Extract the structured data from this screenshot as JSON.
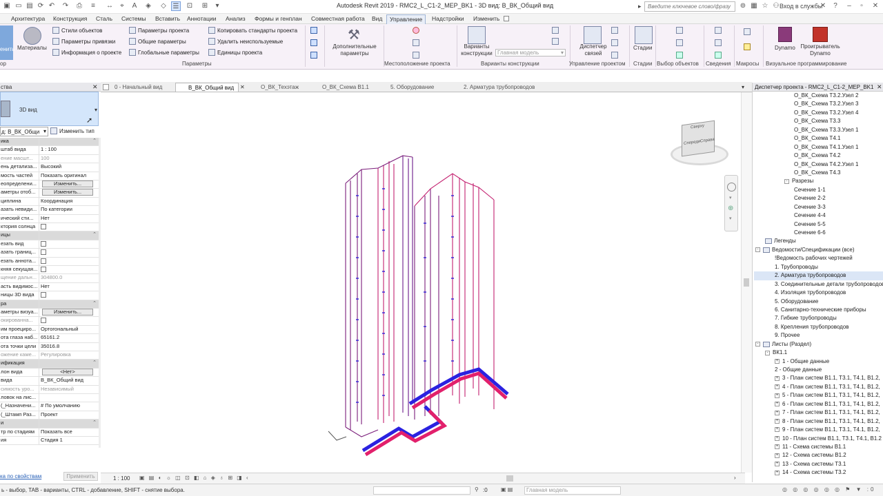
{
  "window": {
    "title": "Autodesk Revit 2019 - RMC2_L_C1-2_MEP_BK1 - 3D вид: В_ВК_Общий вид"
  },
  "search": {
    "placeholder": "Введите ключевое слово/фразу"
  },
  "account": {
    "signin": "Вход в службы"
  },
  "menu": {
    "tabs": [
      "Архитектура",
      "Конструкция",
      "Сталь",
      "Системы",
      "Вставить",
      "Аннотации",
      "Анализ",
      "Формы и генплан",
      "Совместная работа",
      "Вид",
      "Управление",
      "Надстройки",
      "Изменить"
    ],
    "active": "Управление"
  },
  "ribbon": {
    "left_label": "енить",
    "materials_label": "Материалы",
    "col1": [
      "Стили объектов",
      "Параметры привязки",
      "Информация о проекте"
    ],
    "col2": [
      "Параметры проекта",
      "Общие параметры",
      "Глобальные параметры"
    ],
    "col3": [
      "Копировать стандарты проекта",
      "Удалить неиспользуемые",
      "Единицы проекта"
    ],
    "addparams_label": "Дополнительные параметры",
    "design_options_label": "Варианты конструкции",
    "main_model": "Главная модель",
    "link_manager_label": "Диспетчер связей",
    "phases_label": "Стадии",
    "dynamo_label": "Dynamo",
    "dynamo_player_label": "Проигрыватель Dynamo",
    "panels": {
      "p_left": "ор",
      "params": "Параметры",
      "location": "Местоположение проекта",
      "design": "Варианты конструкции",
      "manage": "Управление проектом",
      "phases": "Стадии",
      "selection": "Выбор объектов",
      "inquiry": "Сведения",
      "macros": "Макросы",
      "visual": "Визуальное программирование"
    }
  },
  "properties": {
    "title": "ства",
    "type_name": "3D вид",
    "instance_select": "д: В_ВК_Общи",
    "edit_type": "Изменить тип",
    "rows": [
      {
        "k": "ика",
        "v": "",
        "grp": true
      },
      {
        "k": "штаб вида",
        "v": "1 : 100"
      },
      {
        "k": "ение масшт...",
        "v": "100",
        "dim": true
      },
      {
        "k": "ень детализа...",
        "v": "Высокий"
      },
      {
        "k": "мость частей",
        "v": "Показать оригинал"
      },
      {
        "k": "еопределени...",
        "v": "Изменить...",
        "btn": true
      },
      {
        "k": "аметры отоб...",
        "v": "Изменить...",
        "btn": true
      },
      {
        "k": "циплина",
        "v": "Координация"
      },
      {
        "k": "азать невиди...",
        "v": "По категории"
      },
      {
        "k": "ический сти...",
        "v": "Нет"
      },
      {
        "k": "ктория солнца",
        "v": "",
        "cb": true
      },
      {
        "k": "ицы",
        "v": "",
        "grp": true
      },
      {
        "k": "езать вид",
        "v": "",
        "cb": true
      },
      {
        "k": "азать границ...",
        "v": "",
        "cb": true
      },
      {
        "k": "езать аннота...",
        "v": "",
        "cb": true
      },
      {
        "k": "княя секущая...",
        "v": "",
        "cb": true
      },
      {
        "k": "щение дальн...",
        "v": "304800.0",
        "dim": true
      },
      {
        "k": "асть видимос...",
        "v": "Нет"
      },
      {
        "k": "ницы 3D вида",
        "v": "",
        "cb": true
      },
      {
        "k": "ра",
        "v": "",
        "grp": true
      },
      {
        "k": "аметры визуа...",
        "v": "Изменить...",
        "btn": true
      },
      {
        "k": "окированна...",
        "v": "",
        "cb": true,
        "dim": true
      },
      {
        "k": "им проециро...",
        "v": "Ортогональный"
      },
      {
        "k": "ота глаза наб...",
        "v": "65161.2"
      },
      {
        "k": "ота точки цели",
        "v": "35016.8"
      },
      {
        "k": "ожение каме...",
        "v": "Регулировка",
        "dim": true
      },
      {
        "k": "ификация",
        "v": "",
        "grp": true
      },
      {
        "k": "лон вида",
        "v": "<Нет>",
        "btn": true
      },
      {
        "k": "вида",
        "v": "В_ВК_Общий вид"
      },
      {
        "k": "симость уро...",
        "v": "Независимый",
        "dim": true
      },
      {
        "k": "ловок на лис...",
        "v": ""
      },
      {
        "k": "(_Назначени...",
        "v": "# По умолчанию"
      },
      {
        "k": "(_Штамп Раз...",
        "v": "Проект"
      },
      {
        "k": "и",
        "v": "",
        "grp": true
      },
      {
        "k": "тр по стадиям",
        "v": "Показать все"
      },
      {
        "k": "ия",
        "v": "Стадия 1"
      }
    ],
    "help_link": "ка по свойствам",
    "apply": "Применить"
  },
  "view_tabs": [
    {
      "label": "0 - Начальный вид",
      "active": false
    },
    {
      "label": "В_ВК_Общий вид",
      "active": true
    },
    {
      "label": "О_ВК_Техэтаж",
      "active": false
    },
    {
      "label": "О_ВК_Схема В1.1",
      "active": false
    },
    {
      "label": "5. Оборудование",
      "active": false
    },
    {
      "label": "2. Арматура трубопроводов",
      "active": false
    }
  ],
  "viewcube": {
    "faces": [
      "Сверху",
      "Спереди",
      "Справа"
    ]
  },
  "view_control": {
    "scale": "1 : 100"
  },
  "status": {
    "hint": "ь - выбор, TAB - варианты, CTRL - добавление, SHIFT - снятие выбора.",
    "count": ":0",
    "model": "Главная модель"
  },
  "browser": {
    "title": "Диспетчер проекта - RMC2_L_C1-2_MEP_BK1",
    "items": [
      {
        "t": "О_ВК_Схема Т3.2.Узел 2",
        "l": 4
      },
      {
        "t": "О_ВК_Схема Т3.2.Узел 3",
        "l": 4
      },
      {
        "t": "О_ВК_Схема Т3.2.Узел 4",
        "l": 4
      },
      {
        "t": "О_ВК_Схема Т3.3",
        "l": 4
      },
      {
        "t": "О_ВК_Схема Т3.3.Узел 1",
        "l": 4
      },
      {
        "t": "О_ВК_Схема Т4.1",
        "l": 4
      },
      {
        "t": "О_ВК_Схема Т4.1.Узел 1",
        "l": 4
      },
      {
        "t": "О_ВК_Схема Т4.2",
        "l": 4
      },
      {
        "t": "О_ВК_Схема Т4.2.Узел 1",
        "l": 4
      },
      {
        "t": "О_ВК_Схема Т4.3",
        "l": 4
      },
      {
        "t": "Разрезы",
        "l": 3,
        "tg": "-"
      },
      {
        "t": "Сечение 1-1",
        "l": 4
      },
      {
        "t": "Сечение 2-2",
        "l": 4
      },
      {
        "t": "Сечение 3-3",
        "l": 4
      },
      {
        "t": "Сечение 4-4",
        "l": 4
      },
      {
        "t": "Сечение 5-5",
        "l": 4
      },
      {
        "t": "Сечение 6-6",
        "l": 4
      },
      {
        "t": "Легенды",
        "l": 1,
        "icon": true
      },
      {
        "t": "Ведомости/Спецификации (все)",
        "l": 0,
        "tg": "-",
        "icon": true
      },
      {
        "t": "!Ведомость рабочих чертежей",
        "l": 2
      },
      {
        "t": "1. Трубопроводы",
        "l": 2
      },
      {
        "t": "2. Арматура трубопроводов",
        "l": 2,
        "sel": true
      },
      {
        "t": "3. Соединительные детали трубопроводов",
        "l": 2
      },
      {
        "t": "4. Изоляция трубопроводов",
        "l": 2
      },
      {
        "t": "5. Оборудование",
        "l": 2
      },
      {
        "t": "6. Санитарно-технические приборы",
        "l": 2
      },
      {
        "t": "7. Гибкие трубопроводы",
        "l": 2
      },
      {
        "t": "8. Крепления трубопроводов",
        "l": 2
      },
      {
        "t": "9. Прочее",
        "l": 2
      },
      {
        "t": "Листы (Раздел)",
        "l": 0,
        "tg": "-",
        "icon": true
      },
      {
        "t": "ВК1.1",
        "l": 1,
        "tg": "-"
      },
      {
        "t": "1 - Общие данные",
        "l": 2,
        "tg": "+"
      },
      {
        "t": "2 - Общие данные",
        "l": 2
      },
      {
        "t": "3 - План систем В1.1, Т3.1, Т4.1, В1.2,",
        "l": 2,
        "tg": "+"
      },
      {
        "t": "4 - План систем В1.1, Т3.1, Т4.1, В1.2,",
        "l": 2,
        "tg": "+"
      },
      {
        "t": "5 - План систем В1.1, Т3.1, Т4.1, В1.2,",
        "l": 2,
        "tg": "+"
      },
      {
        "t": "6 - План систем В1.1, Т3.1, Т4.1, В1.2,",
        "l": 2,
        "tg": "+"
      },
      {
        "t": "7 - План систем В1.1, Т3.1, Т4.1, В1.2,",
        "l": 2,
        "tg": "+"
      },
      {
        "t": "8 - План систем В1.1, Т3.1, Т4.1, В1.2,",
        "l": 2,
        "tg": "+"
      },
      {
        "t": "9 - План систем В1.1, Т3.1, Т4.1, В1.2,",
        "l": 2,
        "tg": "+"
      },
      {
        "t": "10 - План систем В1.1, Т3.1, Т4.1, В1.2",
        "l": 2,
        "tg": "+"
      },
      {
        "t": "11 - Схема системы В1.1",
        "l": 2,
        "tg": "+"
      },
      {
        "t": "12 - Схема системы В1.2",
        "l": 2,
        "tg": "+"
      },
      {
        "t": "13 - Схема системы Т3.1",
        "l": 2,
        "tg": "+"
      },
      {
        "t": "14 - Схема системы Т3.2",
        "l": 2,
        "tg": "+"
      }
    ]
  }
}
